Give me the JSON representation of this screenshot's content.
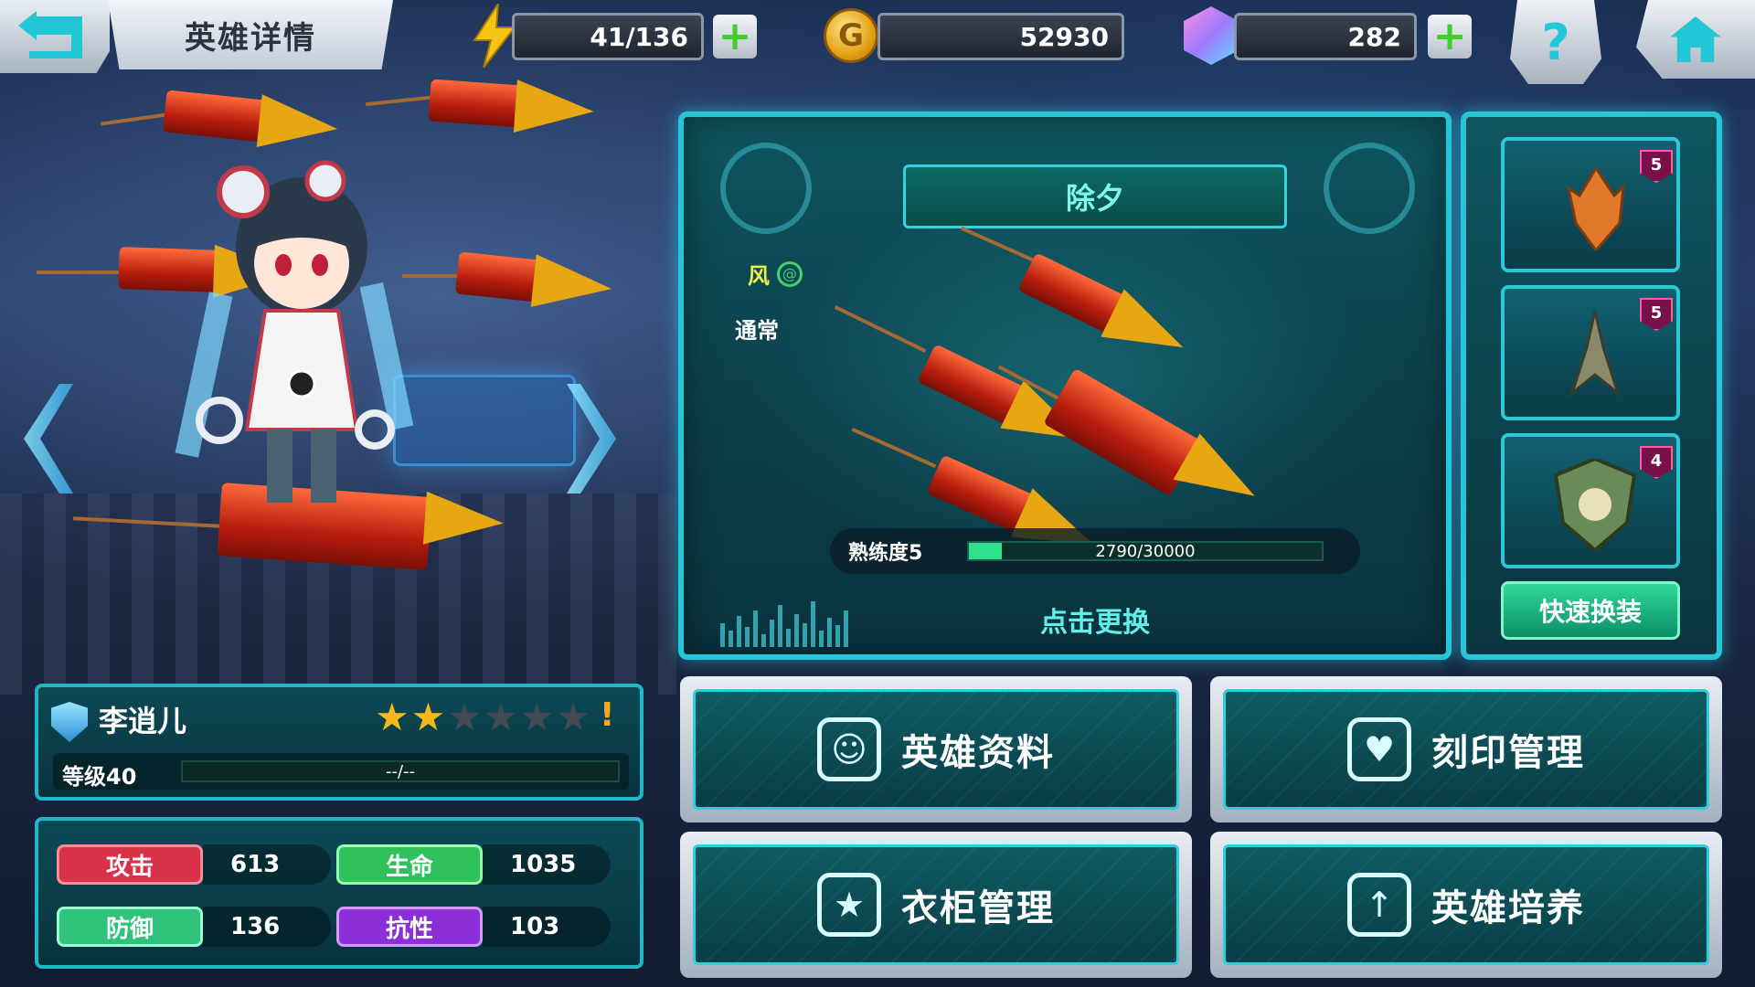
{
  "header": {
    "title": "英雄详情",
    "energy": "41/136",
    "gold": "52930",
    "gems": "282"
  },
  "weapon": {
    "name": "除夕",
    "element": "风",
    "attack_type": "通常",
    "proficiency_label": "熟练度5",
    "proficiency_value": "2790/30000",
    "proficiency_fraction": 0.093,
    "change_label": "点击更换"
  },
  "slots": [
    {
      "level": "5",
      "icon": "flame-claw-icon"
    },
    {
      "level": "5",
      "icon": "dagger-icon"
    },
    {
      "level": "4",
      "icon": "badge-crest-icon"
    }
  ],
  "quick_equip_label": "快速换装",
  "hero": {
    "name": "李逍儿",
    "stars_total": 6,
    "stars_filled": 2,
    "alert": "!",
    "level_label": "等级40",
    "exp_text": "--/--"
  },
  "stats": [
    {
      "label": "攻击",
      "value": "613",
      "color": "#d8324a"
    },
    {
      "label": "生命",
      "value": "1035",
      "color": "#2fc25a"
    },
    {
      "label": "防御",
      "value": "136",
      "color": "#2fc27a"
    },
    {
      "label": "抗性",
      "value": "103",
      "color": "#8b2fd8"
    }
  ],
  "menu": [
    {
      "label": "英雄资料",
      "icon": "hero-profile-icon",
      "glyph": "☺"
    },
    {
      "label": "刻印管理",
      "icon": "engraving-icon",
      "glyph": "♥"
    },
    {
      "label": "衣柜管理",
      "icon": "wardrobe-icon",
      "glyph": "★"
    },
    {
      "label": "英雄培养",
      "icon": "hero-upgrade-icon",
      "glyph": "↑"
    }
  ]
}
